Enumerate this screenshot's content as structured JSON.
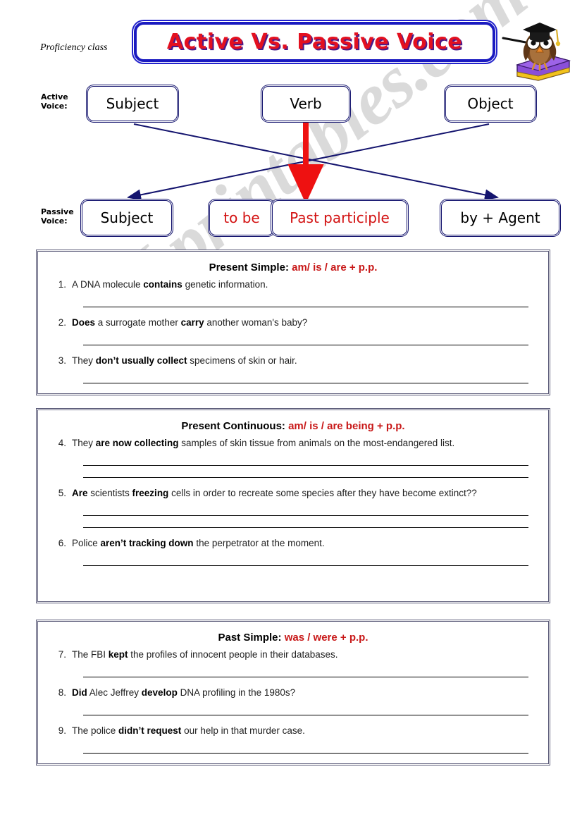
{
  "header": {
    "course_label": "Proficiency class",
    "title": "Active Vs. Passive Voice",
    "title_color": "#e31020",
    "title_shadow_color": "#4a1a8a",
    "title_border_color": "#2222cc",
    "owl_icon": "owl-graduate-icon"
  },
  "diagram": {
    "active_label": "Active\nVoice:",
    "passive_label": "Passive\nVoice:",
    "active_boxes": [
      {
        "label": "Subject",
        "color": "#000000"
      },
      {
        "label": "Verb",
        "color": "#000000"
      },
      {
        "label": "Object",
        "color": "#000000"
      }
    ],
    "passive_boxes": [
      {
        "label": "Subject",
        "color": "#000000"
      },
      {
        "label": "to be",
        "color": "#d31212"
      },
      {
        "label": "Past participle",
        "color": "#d31212"
      },
      {
        "label_red": "by",
        "label_black": " + Agent",
        "color": "#d31212"
      }
    ],
    "arrow_colors": {
      "cross": "#14146e",
      "vertical": "#ee1111"
    },
    "box_border_color": "#14146e"
  },
  "sections": [
    {
      "tense": "Present Simple: ",
      "formula": "am/ is / are  + p.p.",
      "items": [
        {
          "num": "1.",
          "parts": [
            {
              "t": "A DNA molecule ",
              "b": false
            },
            {
              "t": "contains",
              "b": true
            },
            {
              "t": " genetic information.",
              "b": false
            }
          ],
          "lines": 1
        },
        {
          "num": "2.",
          "parts": [
            {
              "t": "Does",
              "b": true
            },
            {
              "t": " a surrogate mother ",
              "b": false
            },
            {
              "t": "carry",
              "b": true
            },
            {
              "t": " another woman's baby?",
              "b": false
            }
          ],
          "lines": 1
        },
        {
          "num": "3.",
          "parts": [
            {
              "t": "They ",
              "b": false
            },
            {
              "t": "don’t usually collect",
              "b": true
            },
            {
              "t": " specimens of skin or hair.",
              "b": false
            }
          ],
          "lines": 1
        }
      ]
    },
    {
      "tense": "Present Continuous: ",
      "formula": "am/ is / are  being +  p.p.",
      "items": [
        {
          "num": "4.",
          "parts": [
            {
              "t": "They ",
              "b": false
            },
            {
              "t": "are now collecting",
              "b": true
            },
            {
              "t": " samples of skin tissue from animals on the most-endangered list.",
              "b": false
            }
          ],
          "lines": 2
        },
        {
          "num": "5.",
          "parts": [
            {
              "t": "Are",
              "b": true
            },
            {
              "t": " scientists ",
              "b": false
            },
            {
              "t": "freezing",
              "b": true
            },
            {
              "t": " cells in order to recreate some species after they have become extinct??",
              "b": false
            }
          ],
          "lines": 2
        },
        {
          "num": "6.",
          "parts": [
            {
              "t": "Police ",
              "b": false
            },
            {
              "t": "aren’t tracking down",
              "b": true
            },
            {
              "t": " the perpetrator at the moment.",
              "b": false
            }
          ],
          "lines": 1
        }
      ]
    },
    {
      "tense": "Past Simple: ",
      "formula": "was / were +  p.p.",
      "items": [
        {
          "num": "7.",
          "parts": [
            {
              "t": "The FBI ",
              "b": false
            },
            {
              "t": "kept",
              "b": true
            },
            {
              "t": " the profiles of innocent people in their databases.",
              "b": false
            }
          ],
          "lines": 1
        },
        {
          "num": "8.",
          "parts": [
            {
              "t": "Did",
              "b": true
            },
            {
              "t": " Alec Jeffrey ",
              "b": false
            },
            {
              "t": "develop",
              "b": true
            },
            {
              "t": " DNA profiling in the 1980s?",
              "b": false
            }
          ],
          "lines": 1
        },
        {
          "num": "9.",
          "parts": [
            {
              "t": "The police ",
              "b": false
            },
            {
              "t": "didn’t request",
              "b": true
            },
            {
              "t": " our help in that murder case.",
              "b": false
            }
          ],
          "lines": 1
        }
      ]
    }
  ],
  "watermark": {
    "text": "ESLprintables.com",
    "color": "#cccccc"
  }
}
